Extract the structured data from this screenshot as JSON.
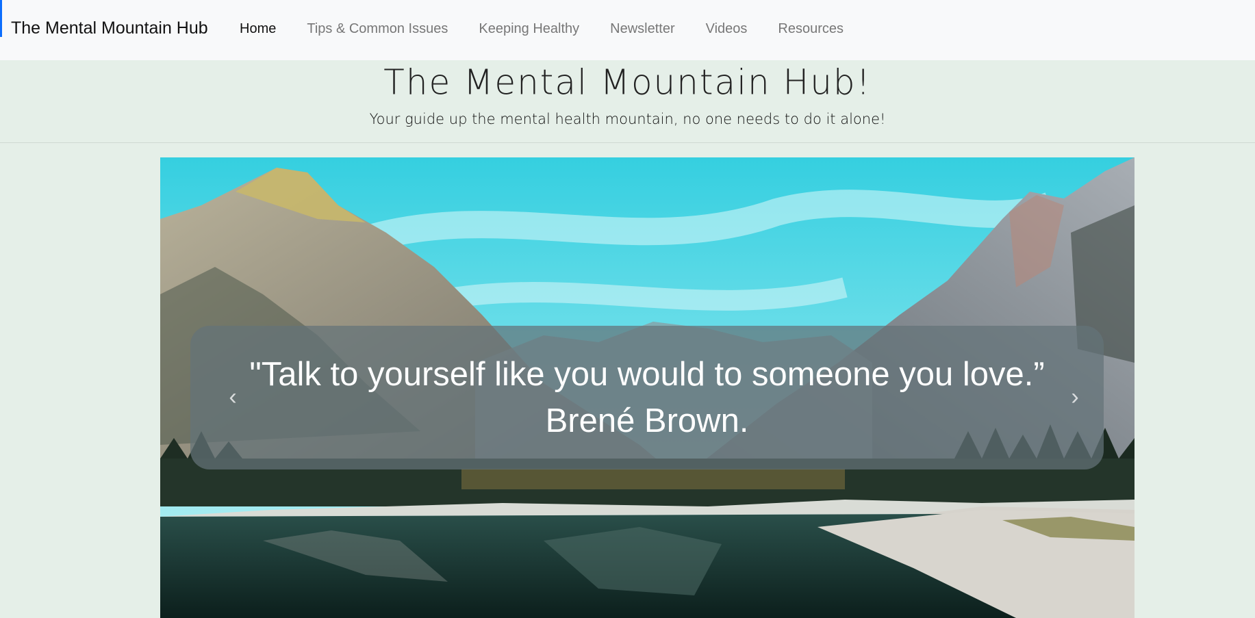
{
  "navbar": {
    "brand": "The Mental Mountain Hub",
    "links": [
      {
        "label": "Home",
        "active": true
      },
      {
        "label": "Tips & Common Issues",
        "active": false
      },
      {
        "label": "Keeping Healthy",
        "active": false
      },
      {
        "label": "Newsletter",
        "active": false
      },
      {
        "label": "Videos",
        "active": false
      },
      {
        "label": "Resources",
        "active": false
      }
    ]
  },
  "header": {
    "title": "The Mental Mountain Hub!",
    "subtitle": "Your guide up the mental health mountain, no one needs to do it alone!"
  },
  "carousel": {
    "quote": "\"Talk to yourself like you would to someone you love.”",
    "author": "Brené Brown.",
    "prev_icon": "chevron-left-icon",
    "next_icon": "chevron-right-icon"
  },
  "colors": {
    "page_background": "#e5efe8",
    "navbar_background": "#f8f9fa",
    "focus_accent": "#0d6efd"
  }
}
